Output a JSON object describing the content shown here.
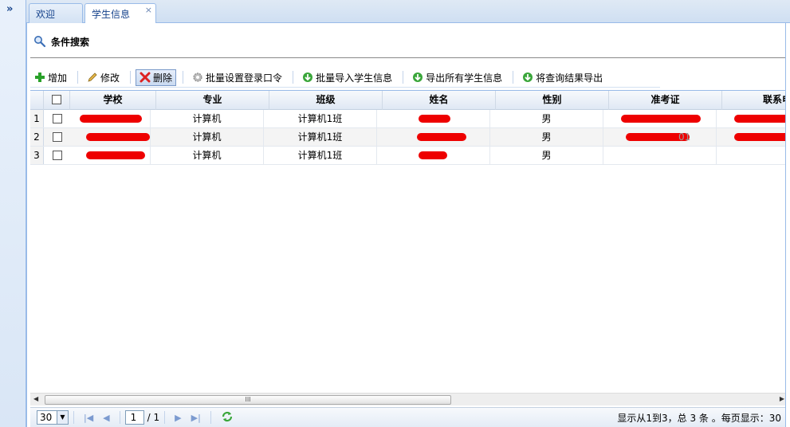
{
  "sidebar": {
    "toggle": "»"
  },
  "tabs": [
    {
      "label": "欢迎",
      "active": false
    },
    {
      "label": "学生信息",
      "active": true,
      "close": "×"
    }
  ],
  "search": {
    "title": "条件搜索"
  },
  "toolbar": {
    "add": "增加",
    "edit": "修改",
    "delete": "删除",
    "batch_password": "批量设置登录口令",
    "batch_import": "批量导入学生信息",
    "export_all": "导出所有学生信息",
    "export_query": "将查询结果导出"
  },
  "grid": {
    "columns": [
      "学校",
      "专业",
      "班级",
      "姓名",
      "性别",
      "准考证",
      "联系电"
    ],
    "rows": [
      {
        "num": "1",
        "major": "计算机",
        "class": "计算机1班",
        "gender": "男",
        "ticket_suffix": ""
      },
      {
        "num": "2",
        "major": "计算机",
        "class": "计算机1班",
        "gender": "男",
        "ticket_suffix": "01"
      },
      {
        "num": "3",
        "major": "计算机",
        "class": "计算机1班",
        "gender": "男",
        "ticket_suffix": ""
      }
    ]
  },
  "scrollbar": {
    "thumb_grip": "III"
  },
  "pager": {
    "page_size": "30",
    "current_page": "1",
    "total_pages": "/ 1",
    "info": "显示从1到3，总 3 条 。每页显示：30"
  },
  "colors": {
    "accent": "#15428b",
    "border": "#99bbe8",
    "redaction": "#ee0000"
  }
}
